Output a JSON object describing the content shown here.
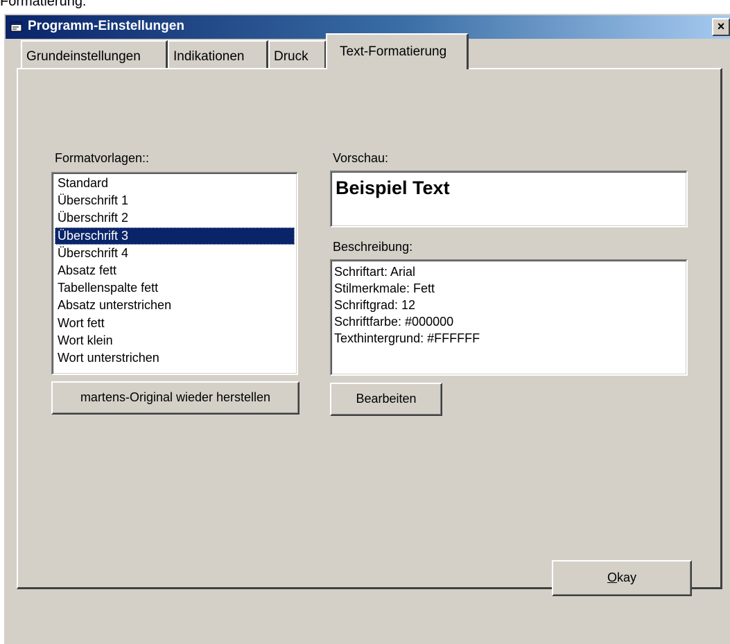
{
  "above_text": "Formatierung:",
  "window": {
    "title": "Programm-Einstellungen",
    "close_label": "×"
  },
  "tabs": [
    {
      "label": "Grundeinstellungen",
      "active": false
    },
    {
      "label": "Indikationen",
      "active": false
    },
    {
      "label": "Druck",
      "active": false
    },
    {
      "label": "Text-Formatierung",
      "active": true
    }
  ],
  "formatvorlagen": {
    "label": "Formatvorlagen::",
    "items": [
      "Standard",
      "Überschrift 1",
      "Überschrift 2",
      "Überschrift 3",
      "Überschrift 4",
      "Absatz fett",
      "Tabellenspalte fett",
      "Absatz unterstrichen",
      "Wort fett",
      "Wort klein",
      "Wort unterstrichen"
    ],
    "selected": "Überschrift 3",
    "restore_button": "martens-Original wieder herstellen"
  },
  "vorschau": {
    "label": "Vorschau:",
    "text": "Beispiel Text"
  },
  "beschreibung": {
    "label": "Beschreibung:",
    "lines": [
      "Schriftart: Arial",
      "Stilmerkmale: Fett",
      "Schriftgrad: 12",
      "Schriftfarbe: #000000",
      "Texthintergrund: #FFFFFF"
    ],
    "edit_button": "Bearbeiten"
  },
  "okay_button": {
    "mnemonic": "O",
    "rest": "kay"
  },
  "colors": {
    "dialog_face": "#d4d0c8",
    "titlebar_start": "#0a246a",
    "titlebar_end": "#a6caf0",
    "selection": "#0a246a"
  },
  "icons": {
    "title_icon": "app-window-icon"
  }
}
